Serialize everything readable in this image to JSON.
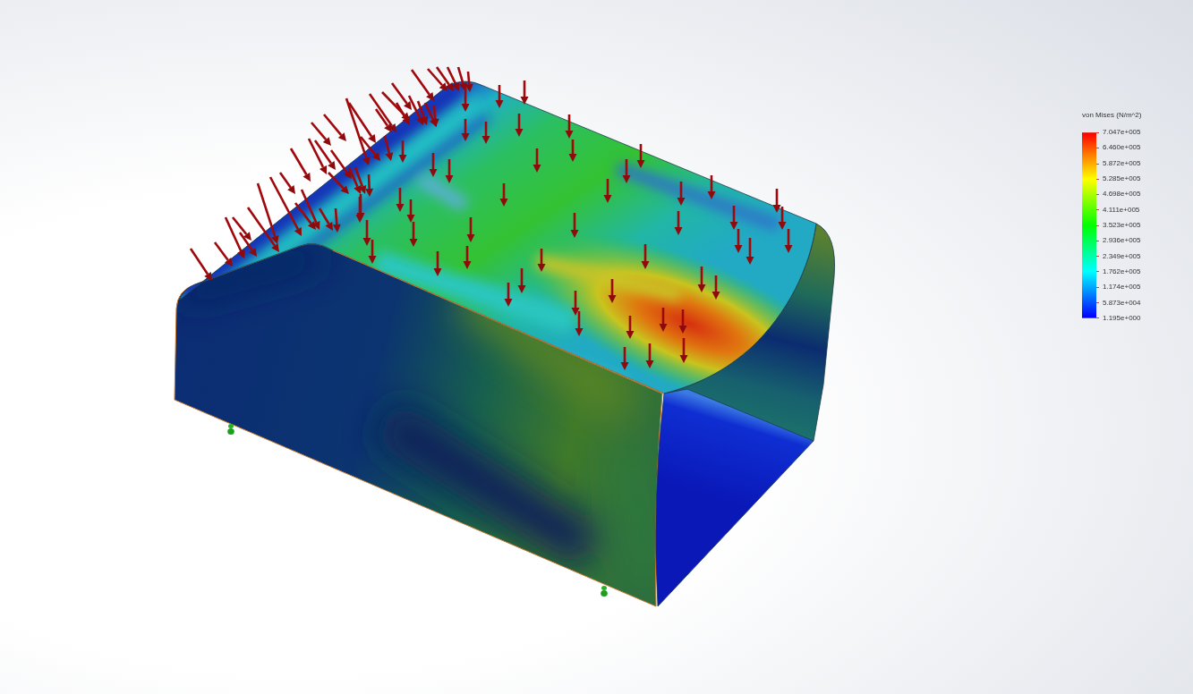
{
  "legend": {
    "title": "von Mises (N/m^2)",
    "labels": [
      "7.047e+005",
      "6.460e+005",
      "5.872e+005",
      "5.285e+005",
      "4.698e+005",
      "4.111e+005",
      "3.523e+005",
      "2.936e+005",
      "2.349e+005",
      "1.762e+005",
      "1.174e+005",
      "5.873e+004",
      "1.195e+000"
    ]
  }
}
